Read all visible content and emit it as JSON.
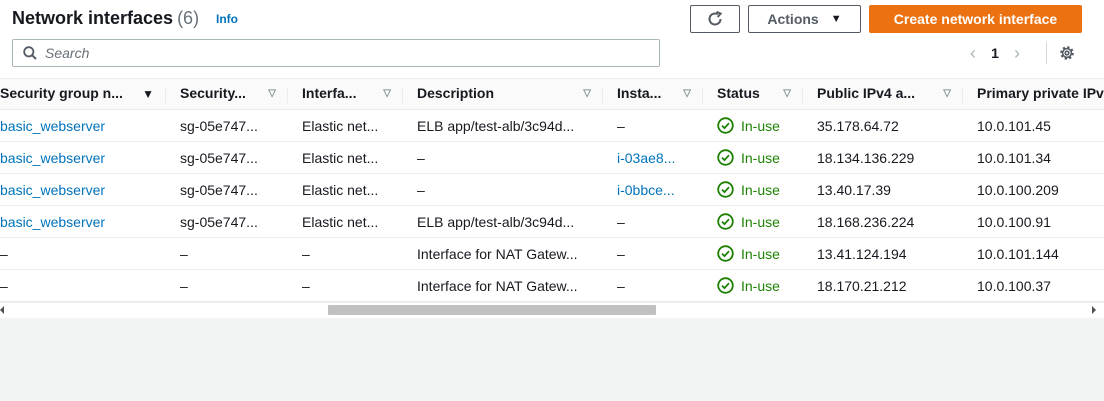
{
  "header": {
    "title": "Network interfaces",
    "count": "(6)",
    "info": "Info",
    "actions_label": "Actions",
    "create_label": "Create network interface"
  },
  "search": {
    "placeholder": "Search"
  },
  "pagination": {
    "page": "1"
  },
  "table": {
    "columns": [
      "Security group n...",
      "Security...",
      "Interfa...",
      "Description",
      "Insta...",
      "Status",
      "Public IPv4 a...",
      "Primary private IPv"
    ],
    "rows": [
      {
        "sg_name": "basic_webserver",
        "sg_id": "sg-05e747...",
        "iface": "Elastic net...",
        "desc": "ELB app/test-alb/3c94d...",
        "inst": "–",
        "status": "In-use",
        "public_ip": "35.178.64.72",
        "private_ip": "10.0.101.45"
      },
      {
        "sg_name": "basic_webserver",
        "sg_id": "sg-05e747...",
        "iface": "Elastic net...",
        "desc": "–",
        "inst": "i-03ae8...",
        "status": "In-use",
        "public_ip": "18.134.136.229",
        "private_ip": "10.0.101.34"
      },
      {
        "sg_name": "basic_webserver",
        "sg_id": "sg-05e747...",
        "iface": "Elastic net...",
        "desc": "–",
        "inst": "i-0bbce...",
        "status": "In-use",
        "public_ip": "13.40.17.39",
        "private_ip": "10.0.100.209"
      },
      {
        "sg_name": "basic_webserver",
        "sg_id": "sg-05e747...",
        "iface": "Elastic net...",
        "desc": "ELB app/test-alb/3c94d...",
        "inst": "–",
        "status": "In-use",
        "public_ip": "18.168.236.224",
        "private_ip": "10.0.100.91"
      },
      {
        "sg_name": "–",
        "sg_id": "–",
        "iface": "–",
        "desc": "Interface for NAT Gatew...",
        "inst": "–",
        "status": "In-use",
        "public_ip": "13.41.124.194",
        "private_ip": "10.0.101.144"
      },
      {
        "sg_name": "–",
        "sg_id": "–",
        "iface": "–",
        "desc": "Interface for NAT Gatew...",
        "inst": "–",
        "status": "In-use",
        "public_ip": "18.170.21.212",
        "private_ip": "10.0.100.37"
      }
    ]
  },
  "colors": {
    "accent": "#ec7211",
    "link": "#0073bb",
    "success": "#1d8102"
  }
}
